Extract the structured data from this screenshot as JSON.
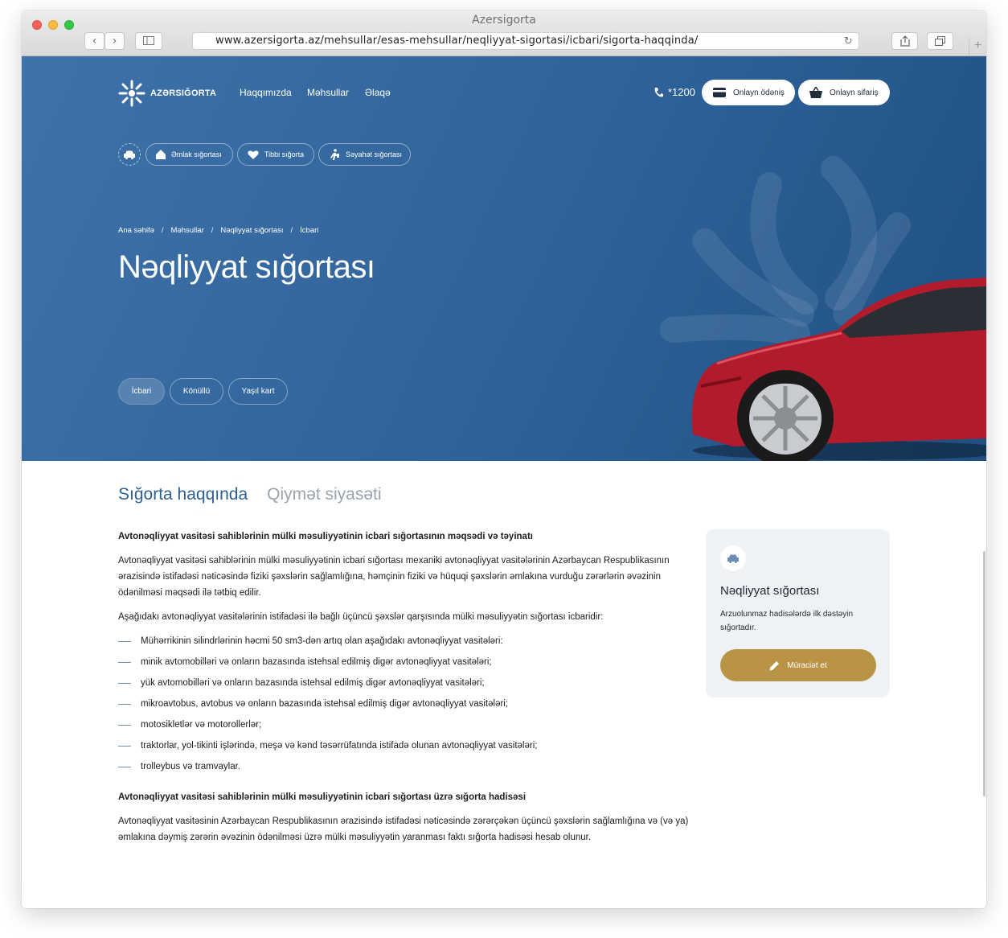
{
  "browser": {
    "window_title": "Azersigorta",
    "url": "www.azersigorta.az/mehsullar/esas-mehsullar/neqliyyat-sigortasi/icbari/sigorta-haqqinda/"
  },
  "header": {
    "logo_text": "AZƏRSIĞORTA",
    "nav": [
      "Haqqımızda",
      "Məhsullar",
      "Əlaqə"
    ],
    "phone": "*1200",
    "online_payment": "Onlayn ödəniş",
    "online_order": "Onlayn sifariş"
  },
  "categories": [
    "Əmlak sığortası",
    "Tibbi sığorta",
    "Səyahət sığortası"
  ],
  "breadcrumb": [
    "Ana səhifə",
    "Məhsullar",
    "Nəqliyyat sığortası",
    "İcbari"
  ],
  "breadcrumb_sep": "/",
  "hero": {
    "title": "Nəqliyyat sığortası",
    "tabs": [
      "İcbari",
      "Könüllü",
      "Yaşıl kart"
    ]
  },
  "content_tabs": [
    "Sığorta haqqında",
    "Qiymət siyasəti"
  ],
  "content": {
    "heading1": "Avtonəqliyyat vasitəsi sahiblərinin mülki məsuliyyətinin icbari sığortasının məqsədi və təyinatı",
    "para1": "Avtonəqliyyat vasitəsi sahiblərinin mülki məsuliyyətinin icbari sığortası mexaniki avtonəqliyyat vasitələrinin Azərbaycan Respublikasının ərazisində istifadəsi nəticəsində fiziki şəxslərin sağlamlığına, həmçinin fiziki və hüquqi şəxslərin əmlakına vurduğu zərərlərin əvəzinin ödənilməsi məqsədi ilə tətbiq edilir.",
    "para2": "Aşağıdakı avtonəqliyyat vasitələrinin istifadəsi ilə bağlı üçüncü şəxslər qarşısında mülki məsuliyyətin sığortası icbaridir:",
    "list": [
      "Mühərrikinin silindrlərinin həcmi 50 sm3-dən artıq olan aşağıdakı avtonəqliyyat vasitələri:",
      "minik avtomobilləri və onların bazasında istehsal edilmiş digər avtonəqliyyat vasitələri;",
      "yük avtomobilləri və onların bazasında istehsal edilmiş digər avtonəqliyyat vasitələri;",
      "mikroavtobus, avtobus və onların bazasında istehsal edilmiş digər avtonəqliyyat vasitələri;",
      "motosikletlər və motorollerlər;",
      "traktorlar, yol-tikinti işlərində, meşə və kənd təsərrüfatında istifadə olunan avtonəqliyyat vasitələri;",
      "trolleybus və tramvaylar."
    ],
    "heading2": "Avtonəqliyyat vasitəsi sahiblərinin mülki məsuliyyətinin icbari sığortası üzrə sığorta hadisəsi",
    "para3": "Avtonəqliyyat vasitəsinin Azərbaycan Respublikasının ərazisində istifadəsi nəticəsində zərərçəkən üçüncü şəxslərin sağlamlığına və (və ya) əmlakına dəymiş zərərin əvəzinin ödənilməsi üzrə mülki məsuliyyətin yaranması faktı sığorta hadisəsi hesab olunur."
  },
  "side_card": {
    "title": "Nəqliyyat sığortası",
    "description": "Arzuolunmaz hadisələrdə ilk dəstəyin sığortadır.",
    "button": "Müraciət et"
  },
  "colors": {
    "hero_blue": "#2e6299",
    "accent_gold": "#b99447",
    "active_tab": "#2e5f93"
  }
}
